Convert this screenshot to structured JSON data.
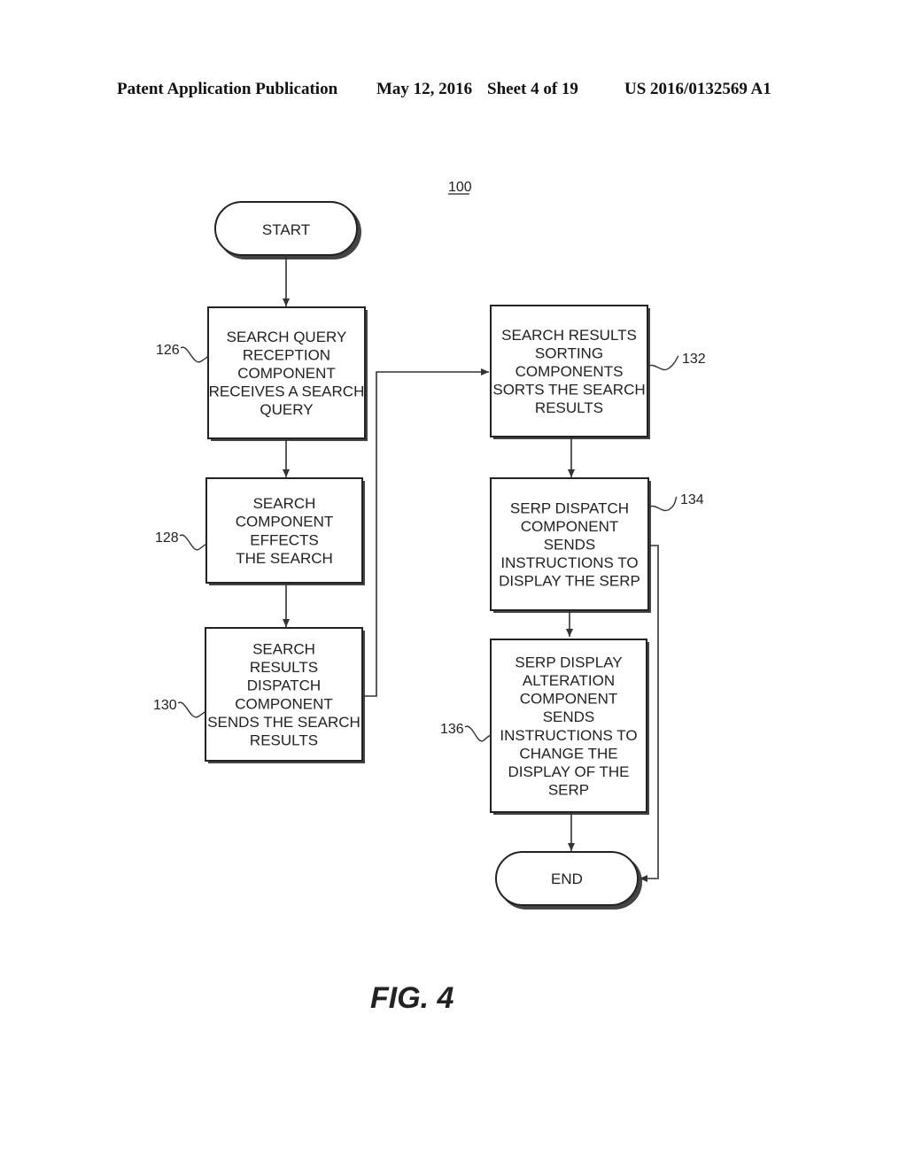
{
  "header": {
    "publication": "Patent Application Publication",
    "date": "May 12, 2016",
    "sheet": "Sheet 4 of 19",
    "number": "US 2016/0132569 A1"
  },
  "figure": {
    "ref": "100",
    "caption": "FIG. 4"
  },
  "flow": {
    "start": "START",
    "end": "END",
    "steps": [
      {
        "id": "126",
        "lines": [
          "SEARCH QUERY",
          "RECEPTION",
          "COMPONENT",
          "RECEIVES A SEARCH",
          "QUERY"
        ]
      },
      {
        "id": "128",
        "lines": [
          "SEARCH",
          "COMPONENT",
          "EFFECTS",
          "THE SEARCH"
        ]
      },
      {
        "id": "130",
        "lines": [
          "SEARCH",
          "RESULTS",
          "DISPATCH",
          "COMPONENT",
          "SENDS THE SEARCH",
          "RESULTS"
        ]
      },
      {
        "id": "132",
        "lines": [
          "SEARCH RESULTS",
          "SORTING",
          "COMPONENTS",
          "SORTS THE SEARCH",
          "RESULTS"
        ]
      },
      {
        "id": "134",
        "lines": [
          "SERP DISPATCH",
          "COMPONENT",
          "SENDS",
          "INSTRUCTIONS TO",
          "DISPLAY THE SERP"
        ]
      },
      {
        "id": "136",
        "lines": [
          "SERP DISPLAY",
          "ALTERATION",
          "COMPONENT",
          "SENDS",
          "INSTRUCTIONS TO",
          "CHANGE THE",
          "DISPLAY OF THE",
          "SERP"
        ]
      }
    ]
  }
}
